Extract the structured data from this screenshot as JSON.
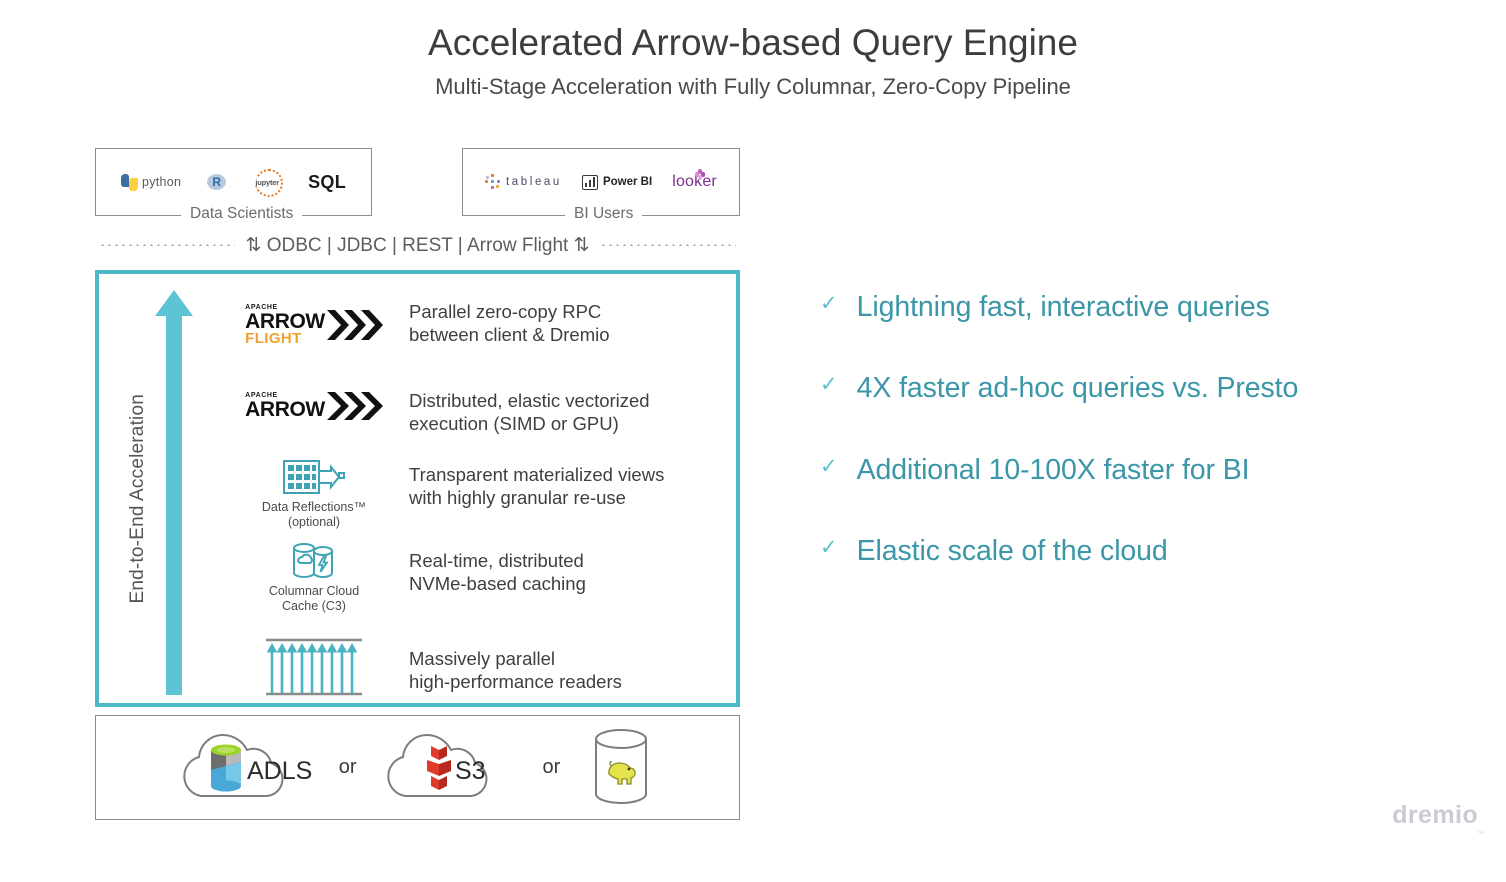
{
  "header": {
    "title": "Accelerated Arrow-based Query Engine",
    "subtitle": "Multi-Stage Acceleration with Fully Columnar, Zero-Copy Pipeline"
  },
  "clients": {
    "data_scientists": {
      "caption": "Data Scientists",
      "logos": [
        {
          "name": "python-logo",
          "label": "python"
        },
        {
          "name": "r-logo",
          "label": "R"
        },
        {
          "name": "jupyter-logo",
          "label": "jupyter"
        },
        {
          "name": "sql-logo",
          "label": "SQL"
        }
      ]
    },
    "bi_users": {
      "caption": "BI Users",
      "logos": [
        {
          "name": "tableau-logo",
          "label": "tableau"
        },
        {
          "name": "powerbi-logo",
          "label": "Power BI"
        },
        {
          "name": "looker-logo",
          "label": "looker"
        }
      ]
    }
  },
  "connector": {
    "arrow_left": "⇅",
    "text": "ODBC | JDBC | REST | Arrow Flight",
    "arrow_right": "⇅"
  },
  "acceleration": {
    "vertical_label": "End-to-End Acceleration",
    "arrow_icon": "up-arrow-icon",
    "rows": [
      {
        "icon": "apache-arrow-flight-logo",
        "icon_top": "APACHE",
        "icon_main": "ARROW",
        "icon_sub": "FLIGHT",
        "caption": "",
        "text_line1": "Parallel zero-copy RPC",
        "text_line2": "between client & Dremio"
      },
      {
        "icon": "apache-arrow-logo",
        "icon_top": "APACHE",
        "icon_main": "ARROW",
        "icon_sub": "",
        "caption": "",
        "text_line1": "Distributed, elastic vectorized",
        "text_line2": "execution (SIMD or GPU)"
      },
      {
        "icon": "data-reflections-icon",
        "caption_line1": "Data Reflections™",
        "caption_line2": "(optional)",
        "text_line1": "Transparent materialized views",
        "text_line2": "with highly granular re-use"
      },
      {
        "icon": "columnar-cloud-cache-icon",
        "caption_line1": "Columnar Cloud",
        "caption_line2": "Cache (C3)",
        "text_line1": "Real-time, distributed",
        "text_line2": "NVMe-based caching"
      },
      {
        "icon": "parallel-readers-icon",
        "caption_line1": "",
        "caption_line2": "",
        "text_line1": "Massively parallel",
        "text_line2": "high-performance readers"
      }
    ]
  },
  "storage": {
    "items": [
      {
        "icon": "adls-cloud-icon",
        "label": "ADLS"
      },
      {
        "icon": "s3-cloud-icon",
        "label": "S3"
      },
      {
        "icon": "hadoop-cylinder-icon",
        "label": ""
      }
    ],
    "separator": "or"
  },
  "benefits": {
    "check_glyph": "✓",
    "items": [
      "Lightning fast, interactive queries",
      "4X faster ad-hoc queries vs. Presto",
      "Additional 10-100X faster for BI",
      "Elastic scale of the cloud"
    ]
  },
  "footer": {
    "brand": "dremio",
    "trademark": "™"
  },
  "colors": {
    "teal_border": "#4cb9c9",
    "teal_text": "#3b96a8",
    "arrow_orange": "#f0a22e",
    "box_gray": "#8c8c8c"
  }
}
